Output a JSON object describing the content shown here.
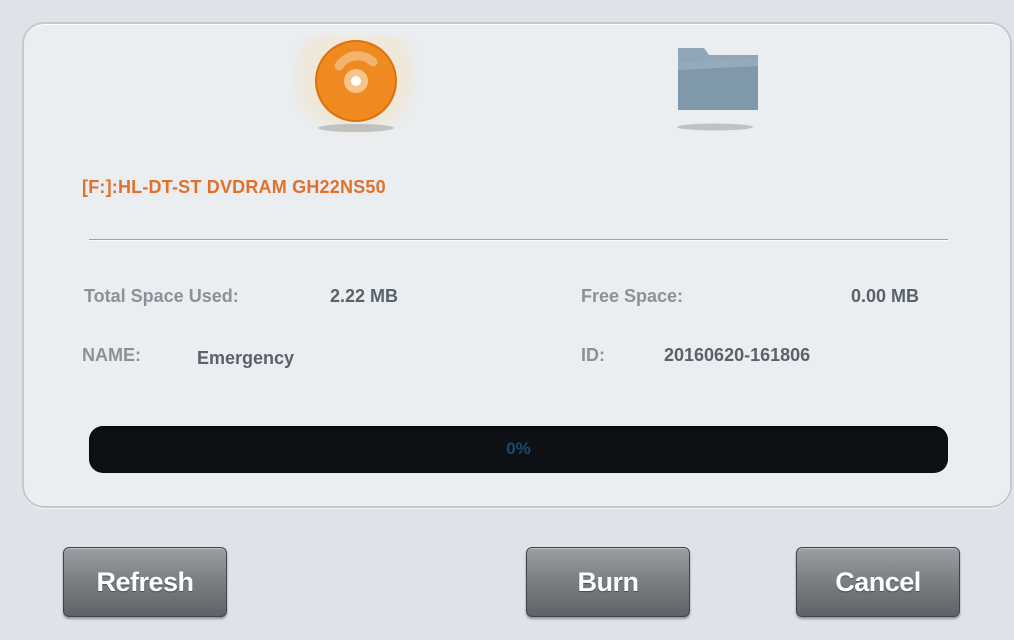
{
  "media": {
    "disc_icon": "disc-icon",
    "folder_icon": "folder-icon"
  },
  "device": {
    "label": "[F:]:HL-DT-ST DVDRAM GH22NS50"
  },
  "info": {
    "total_space_label": "Total Space Used:",
    "total_space_value": "2.22 MB",
    "free_space_label": "Free Space:",
    "free_space_value": "0.00 MB",
    "name_label": "NAME:",
    "name_value": "Emergency",
    "id_label": "ID:",
    "id_value": "20160620-161806"
  },
  "progress": {
    "value": 0,
    "text": "0%"
  },
  "buttons": {
    "refresh": "Refresh",
    "burn": "Burn",
    "cancel": "Cancel"
  },
  "colors": {
    "device_label": "#e0702a",
    "disc": "#f08a1c",
    "progress_track": "#0d1116"
  }
}
